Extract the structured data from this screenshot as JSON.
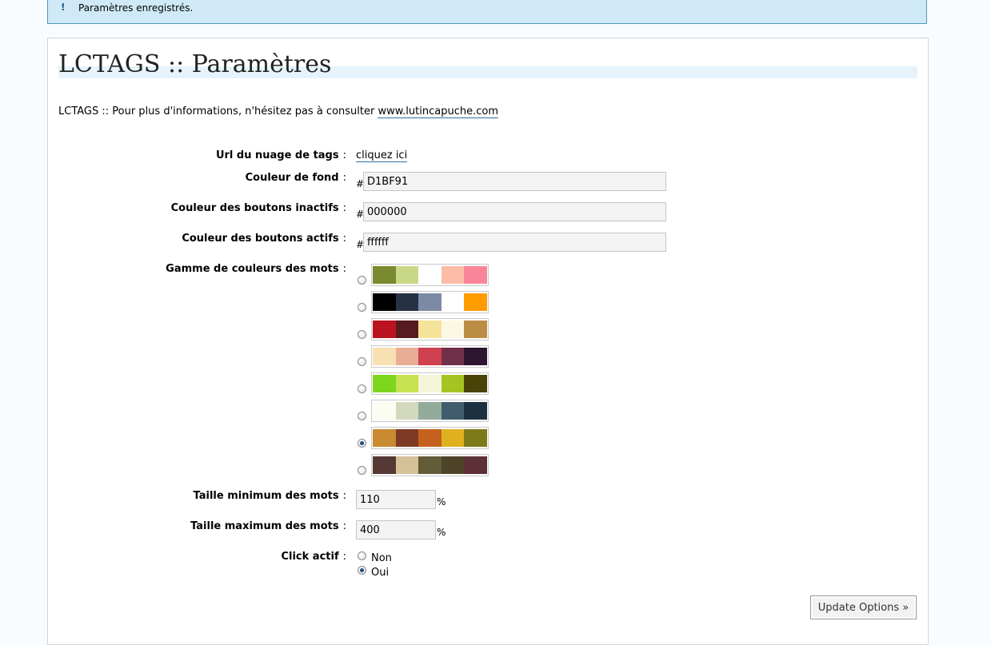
{
  "notice": {
    "bang": "!",
    "message": "Paramètres enregistrés."
  },
  "page_title": "LCTAGS :: Paramètres",
  "info": {
    "text": "LCTAGS :: Pour plus d'informations, n'hésitez pas à consulter ",
    "link": "www.lutincapuche.com"
  },
  "fields": {
    "cloud_url": {
      "label": "Url du nuage de tags",
      "link": "cliquez ici"
    },
    "bg_color": {
      "label": "Couleur de fond",
      "prefix": "#",
      "value": "D1BF91"
    },
    "inactive_color": {
      "label": "Couleur des boutons inactifs",
      "prefix": "#",
      "value": "000000"
    },
    "active_color": {
      "label": "Couleur des boutons actifs",
      "prefix": "#",
      "value": "ffffff"
    },
    "palette": {
      "label": "Gamme de couleurs des mots",
      "selected_index": 6,
      "options": [
        [
          "#7a8a2e",
          "#c9d886",
          "#ffffff",
          "#fbbca8",
          "#fb8598"
        ],
        [
          "#000000",
          "#263244",
          "#7d8aa6",
          "#ffffff",
          "#ff9c00"
        ],
        [
          "#bb1320",
          "#561a1f",
          "#f6e39a",
          "#fcf8e3",
          "#bc8e45"
        ],
        [
          "#f7e1b2",
          "#e8ae95",
          "#cf4150",
          "#70304a",
          "#2e1532"
        ],
        [
          "#7dd61e",
          "#c7e250",
          "#f3f4d8",
          "#a6c421",
          "#4a4307"
        ],
        [
          "#fcfcf3",
          "#d2d9bd",
          "#93ab9b",
          "#405d6e",
          "#1b3142"
        ],
        [
          "#c98a32",
          "#7f3a23",
          "#c5611e",
          "#dfb11e",
          "#7d7a1a"
        ],
        [
          "#563835",
          "#d4c197",
          "#625c38",
          "#4d4428",
          "#5d2f37"
        ]
      ]
    },
    "min_size": {
      "label": "Taille minimum des mots",
      "value": "110",
      "unit": "%"
    },
    "max_size": {
      "label": "Taille maximum des mots",
      "value": "400",
      "unit": "%"
    },
    "click": {
      "label": "Click actif",
      "options": [
        "Non",
        "Oui"
      ],
      "selected": "Oui"
    }
  },
  "colon": ":",
  "submit_label": "Update Options »"
}
